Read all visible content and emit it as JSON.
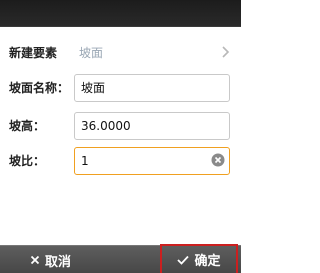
{
  "form": {
    "new_element": {
      "label": "新建要素",
      "value": "坡面"
    },
    "slope_name": {
      "label": "坡面名称：",
      "value": "坡面"
    },
    "slope_height": {
      "label": "坡高：",
      "value": "36.0000"
    },
    "slope_ratio": {
      "label": "坡比：",
      "value": "1"
    }
  },
  "footer": {
    "cancel_label": "取消",
    "confirm_label": "确定"
  }
}
